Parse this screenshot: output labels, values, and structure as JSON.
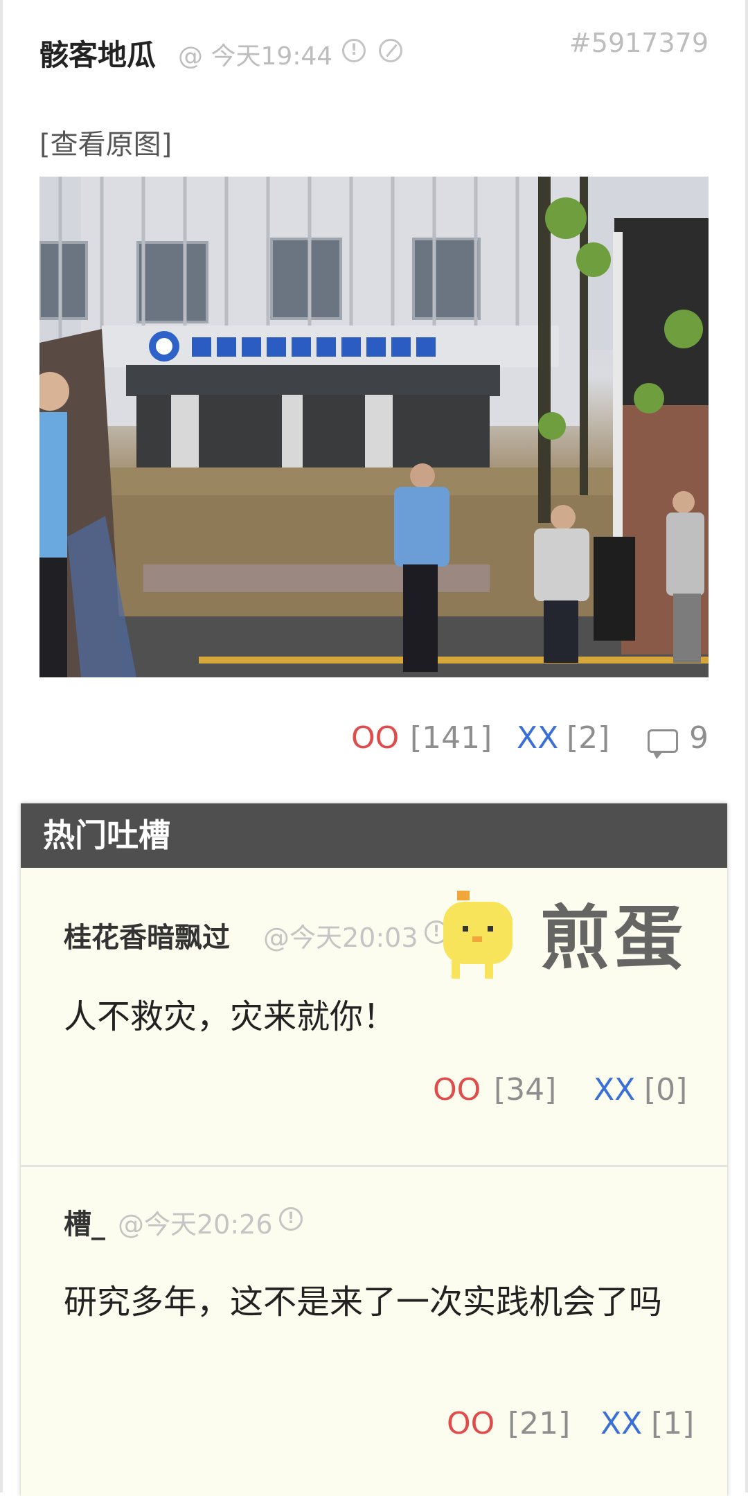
{
  "post": {
    "author": "骸客地瓜",
    "time": "@ 今天19:44",
    "id": "#5917379",
    "view_original": "[查看原图]",
    "image_alt": "中国应急管理研究中心",
    "oo_label": "OO",
    "oo_count": "[141]",
    "xx_label": "XX",
    "xx_count": "[2]",
    "comment_count": "9"
  },
  "hot": {
    "title": "热门吐槽",
    "comments": [
      {
        "author": "桂花香暗飘过",
        "time": "@今天20:03",
        "text": "人不救灾，灾来就你！",
        "oo_label": "OO",
        "oo_count": "[34]",
        "xx_label": "XX",
        "xx_count": "[0]"
      },
      {
        "author": "槽_",
        "time": "@今天20:26",
        "text": "研究多年，这不是来了一次实践机会了吗",
        "oo_label": "OO",
        "oo_count": "[21]",
        "xx_label": "XX",
        "xx_count": "[1]"
      }
    ]
  },
  "watermark": {
    "text": "煎蛋"
  },
  "icons": {
    "report": "exclamation-circle-icon",
    "block": "slash-circle-icon",
    "comment": "speech-bubble-icon",
    "mascot": "chick-icon"
  },
  "colors": {
    "oo": "#e04b4b",
    "xx": "#3a6fd8",
    "header": "#4f4f4f",
    "hot_bg": "#fcfdee"
  }
}
